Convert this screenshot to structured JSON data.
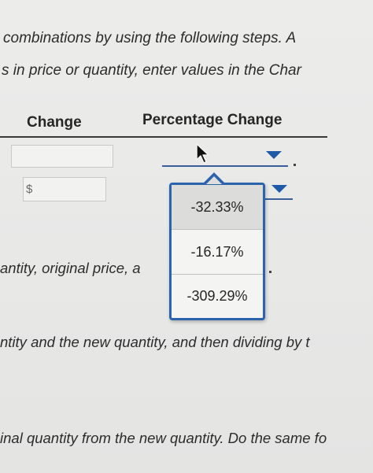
{
  "instructions": {
    "line1": "combinations by using the following steps. A",
    "line2": "s in price or quantity, enter values in the Char",
    "line3": "antity, original price, a",
    "line4": "ntity and the new quantity, and then dividing by t",
    "line5": "inal quantity from the new quantity. Do the same fo"
  },
  "table": {
    "header_change": "Change",
    "header_percentage_change": "Percentage Change",
    "currency_symbol": "$"
  },
  "dropdown": {
    "options": [
      "-32.33%",
      "-16.17%",
      "-309.29%"
    ],
    "highlighted_index": 0
  },
  "colors": {
    "accent": "#2b63ad",
    "caret": "#1f5aa8",
    "underline": "#3a5f9a"
  },
  "icons": {
    "cursor": "mouse-pointer-icon",
    "caret": "chevron-down-icon"
  }
}
